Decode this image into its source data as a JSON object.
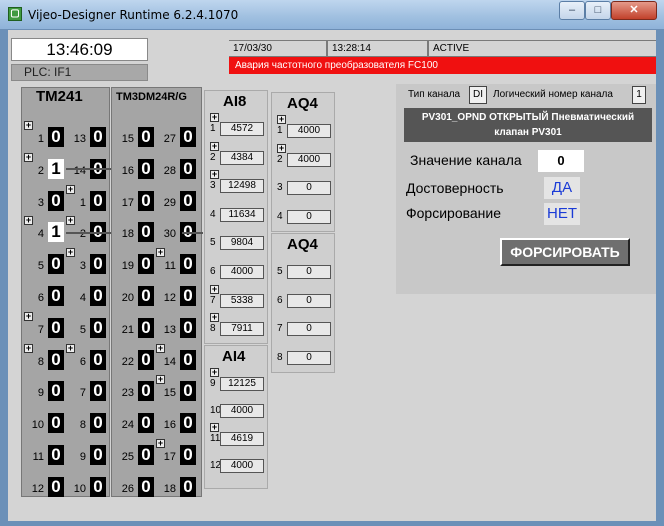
{
  "window": {
    "title": "Vijeo-Designer Runtime 6.2.4.1070",
    "min": "–",
    "max": "□",
    "close": "✕"
  },
  "header": {
    "clock": "13:46:09",
    "plc": "PLC: IF1",
    "alarm": {
      "date": "17/03/30",
      "time": "13:28:14",
      "status": "ACTIVE",
      "message": "Авария частотного преобразователя FC100"
    }
  },
  "tm241": {
    "title": "TM241",
    "left": [
      {
        "n": "1",
        "v": "0"
      },
      {
        "n": "2",
        "v": "1"
      },
      {
        "n": "3",
        "v": "0"
      },
      {
        "n": "4",
        "v": "1"
      },
      {
        "n": "5",
        "v": "0"
      },
      {
        "n": "6",
        "v": "0"
      },
      {
        "n": "7",
        "v": "0"
      },
      {
        "n": "8",
        "v": "0"
      },
      {
        "n": "9",
        "v": "0"
      },
      {
        "n": "10",
        "v": "0"
      },
      {
        "n": "11",
        "v": "0"
      },
      {
        "n": "12",
        "v": "0"
      }
    ],
    "right": [
      {
        "n": "13",
        "v": "0"
      },
      {
        "n": "14",
        "v": "0"
      },
      {
        "n": "1",
        "v": "0"
      },
      {
        "n": "2",
        "v": "0"
      },
      {
        "n": "3",
        "v": "0"
      },
      {
        "n": "4",
        "v": "0"
      },
      {
        "n": "5",
        "v": "0"
      },
      {
        "n": "6",
        "v": "0"
      },
      {
        "n": "7",
        "v": "0"
      },
      {
        "n": "8",
        "v": "0"
      },
      {
        "n": "9",
        "v": "0"
      },
      {
        "n": "10",
        "v": "0"
      }
    ]
  },
  "tm3": {
    "title": "TM3DM24R/G",
    "left": [
      {
        "n": "15",
        "v": "0"
      },
      {
        "n": "16",
        "v": "0"
      },
      {
        "n": "17",
        "v": "0"
      },
      {
        "n": "18",
        "v": "0"
      },
      {
        "n": "19",
        "v": "0"
      },
      {
        "n": "20",
        "v": "0"
      },
      {
        "n": "21",
        "v": "0"
      },
      {
        "n": "22",
        "v": "0"
      },
      {
        "n": "23",
        "v": "0"
      },
      {
        "n": "24",
        "v": "0"
      },
      {
        "n": "25",
        "v": "0"
      },
      {
        "n": "26",
        "v": "0"
      }
    ],
    "right": [
      {
        "n": "27",
        "v": "0"
      },
      {
        "n": "28",
        "v": "0"
      },
      {
        "n": "29",
        "v": "0"
      },
      {
        "n": "30",
        "v": "0"
      },
      {
        "n": "11",
        "v": "0"
      },
      {
        "n": "12",
        "v": "0"
      },
      {
        "n": "13",
        "v": "0"
      },
      {
        "n": "14",
        "v": "0"
      },
      {
        "n": "15",
        "v": "0"
      },
      {
        "n": "16",
        "v": "0"
      },
      {
        "n": "17",
        "v": "0"
      },
      {
        "n": "18",
        "v": "0"
      }
    ]
  },
  "ai8": {
    "title": "AI8",
    "rows": [
      {
        "n": "1",
        "v": "4572"
      },
      {
        "n": "2",
        "v": "4384"
      },
      {
        "n": "3",
        "v": "12498"
      },
      {
        "n": "4",
        "v": "11634"
      },
      {
        "n": "5",
        "v": "9804"
      },
      {
        "n": "6",
        "v": "4000"
      },
      {
        "n": "7",
        "v": "5338"
      },
      {
        "n": "8",
        "v": "7911"
      }
    ]
  },
  "ai4": {
    "title": "AI4",
    "rows": [
      {
        "n": "9",
        "v": "12125"
      },
      {
        "n": "10",
        "v": "4000"
      },
      {
        "n": "11",
        "v": "4619"
      },
      {
        "n": "12",
        "v": "4000"
      }
    ]
  },
  "aq4a": {
    "title": "AQ4",
    "rows": [
      {
        "n": "1",
        "v": "4000"
      },
      {
        "n": "2",
        "v": "4000"
      },
      {
        "n": "3",
        "v": "0"
      },
      {
        "n": "4",
        "v": "0"
      }
    ]
  },
  "aq4b": {
    "title": "AQ4",
    "rows": [
      {
        "n": "5",
        "v": "0"
      },
      {
        "n": "6",
        "v": "0"
      },
      {
        "n": "7",
        "v": "0"
      },
      {
        "n": "8",
        "v": "0"
      }
    ]
  },
  "right_panel": {
    "channel_type_label": "Тип канала",
    "channel_type": "DI",
    "logical_label": "Логический номер канала",
    "logical_number": "1",
    "name_line1": "PV301_OPND ОТКРЫТЫЙ Пневматический",
    "name_line2": "клапан PV301",
    "value_label": "Значение канала",
    "value": "0",
    "validity_label": "Достоверность",
    "validity": "ДА",
    "forcing_label": "Форсирование",
    "forcing": "НЕТ",
    "force_button": "ФОРСИРОВАТЬ"
  }
}
